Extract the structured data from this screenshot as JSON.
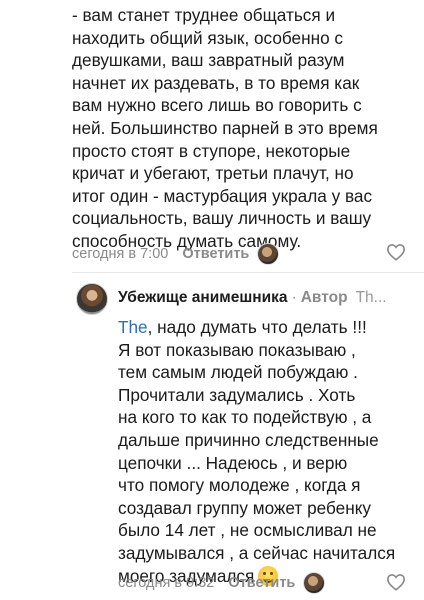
{
  "comment1": {
    "text": "- вам станет труднее общаться и\nнаходить общий язык, особенно с\nдевушками, ваш завратный разум\nначнет их раздевать, в то  время как\nвам нужно всего лишь во говорить с\nней. Большинство парней в это время\nпросто стоят в ступоре, некоторые\nкричат и убегают, третьи плачут, но\nитог один - мастурбация украла у вас\nсоциальность, вашу личность и вашу\nспособность думать самому.",
    "time": "сегодня в 7:00",
    "reply_label": "Ответить"
  },
  "comment2": {
    "author": "Убежище  анимешника",
    "separator": "·",
    "author_badge": "Автор",
    "reply_to_truncated": "Th...",
    "mention": "The",
    "text": ", надо думать что делать !!!\nЯ вот показываю показываю ,\nтем самым людей побуждаю .\nПрочитали задумались . Хоть\nна кого то как то подействую , а\nдальше причинно следственные\nцепочки ... Надеюсь , и верю\nчто помогу молодеже , когда я\nсоздавал группу может ребенку\nбыло 14 лет , не осмысливал не\nзадумывался , а сейчас начитался\nмоего задумался",
    "emoji": "smiling-face-emoji",
    "time": "сегодня в 9:32",
    "reply_label": "Ответить"
  }
}
